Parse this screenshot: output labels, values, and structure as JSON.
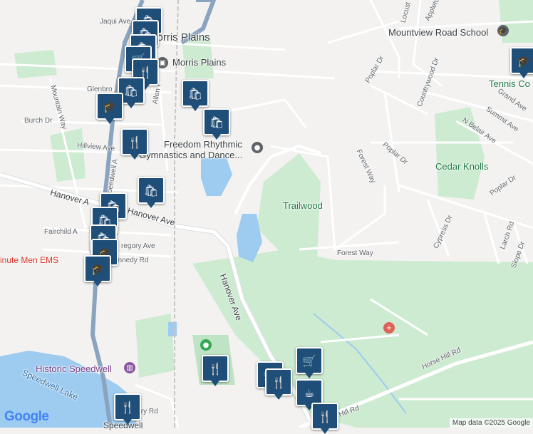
{
  "map": {
    "places": {
      "morris_plains": "Morris Plains",
      "morris_plains_station": "Morris Plains",
      "mountview_school": "Mountview Road School",
      "tennis_court": "Tennis Co",
      "freedom_line1": "Freedom Rhythmic",
      "freedom_line2": "Gymnastics and Dance...",
      "cedar_knolls": "Cedar Knolls",
      "trailwood": "Trailwood",
      "minute_men": "inute Men EMS",
      "historic_speedwell": "Historic Speedwell",
      "speedwell_lake": "Speedwell Lake",
      "speedwell_bottom": "Speedwell"
    },
    "streets": {
      "jaqui": "Jaqui Ave",
      "glenbrook": "Glenbro",
      "burch": "Burch Dr",
      "hillview": "Hillview Ave",
      "mountain_way": "Mountain Way",
      "allen": "Allen P",
      "speedwell_ave": "Speedwell A",
      "hanover_west": "Hanover A",
      "hanover_ave": "Hanover Ave",
      "hanover_ave_south": "Hanover Ave",
      "fairchild": "Fairchild A",
      "gregory": "regory Ave",
      "kennedy": "ennedy Rd",
      "poplar_dr_top": "Poplar Dr",
      "poplar_dr_mid": "Poplar Dr",
      "poplar_dr_right": "Poplar Dr",
      "countrywood": "Countrywood Dr",
      "locust": "Locust",
      "appleton": "Appleto",
      "grand": "Grand Ave",
      "summit": "Summit Ave",
      "n_belair": "N Belair Ave",
      "forest_way_vert": "Forest Way",
      "forest_way": "Forest Way",
      "cypress": "Cypress Dr",
      "larch": "Larch Rd",
      "slope": "Slope Dr",
      "horse_hill": "Horse Hill Rd",
      "hill_rd": "Hill Rd",
      "cory": "Cory Rd"
    },
    "logo": "Google",
    "attribution": "Map data ©2025 Google"
  },
  "markers": [
    {
      "name": "marker-shopping-bag-1",
      "icon": "shopping-bag-icon",
      "glyph": "🛍"
    },
    {
      "name": "marker-shopping-bag-2",
      "icon": "shopping-bag-icon",
      "glyph": "🛍"
    },
    {
      "name": "marker-shopping-bag-3",
      "icon": "shopping-bag-icon",
      "glyph": "🛍"
    },
    {
      "name": "marker-grocery-cart-1",
      "icon": "grocery-cart-icon",
      "glyph": "🛒"
    },
    {
      "name": "marker-restaurant-1",
      "icon": "restaurant-icon",
      "glyph": "🍴"
    },
    {
      "name": "marker-shopping-bag-4",
      "icon": "shopping-bag-icon",
      "glyph": "🛍"
    },
    {
      "name": "marker-education-1",
      "icon": "education-icon",
      "glyph": "🎓"
    },
    {
      "name": "marker-shopping-bag-5",
      "icon": "shopping-bag-icon",
      "glyph": "🛍"
    },
    {
      "name": "marker-shopping-bag-6",
      "icon": "shopping-bag-icon",
      "glyph": "🛍"
    },
    {
      "name": "marker-restaurant-2",
      "icon": "restaurant-icon",
      "glyph": "🍴"
    },
    {
      "name": "marker-shopping-bag-7",
      "icon": "shopping-bag-icon",
      "glyph": "🛍"
    },
    {
      "name": "marker-shopping-bag-8",
      "icon": "shopping-bag-icon",
      "glyph": "🛍"
    },
    {
      "name": "marker-shopping-bag-9",
      "icon": "shopping-bag-icon",
      "glyph": "🛍"
    },
    {
      "name": "marker-shopping-bag-10",
      "icon": "shopping-bag-icon",
      "glyph": "🛍"
    },
    {
      "name": "marker-education-2",
      "icon": "education-icon",
      "glyph": "🎓"
    },
    {
      "name": "marker-education-3",
      "icon": "education-icon",
      "glyph": "🎓"
    },
    {
      "name": "marker-restaurant-3",
      "icon": "restaurant-icon",
      "glyph": "🍴"
    },
    {
      "name": "marker-grocery-cart-2",
      "icon": "grocery-cart-icon",
      "glyph": "🛒"
    },
    {
      "name": "marker-grocery-cart-3",
      "icon": "grocery-cart-icon",
      "glyph": "🛒"
    },
    {
      "name": "marker-restaurant-4",
      "icon": "restaurant-icon",
      "glyph": "🍴"
    },
    {
      "name": "marker-coffee-1",
      "icon": "coffee-icon",
      "glyph": "☕"
    },
    {
      "name": "marker-restaurant-5",
      "icon": "restaurant-icon",
      "glyph": "🍴"
    },
    {
      "name": "marker-restaurant-6",
      "icon": "restaurant-icon",
      "glyph": "🍴"
    }
  ]
}
